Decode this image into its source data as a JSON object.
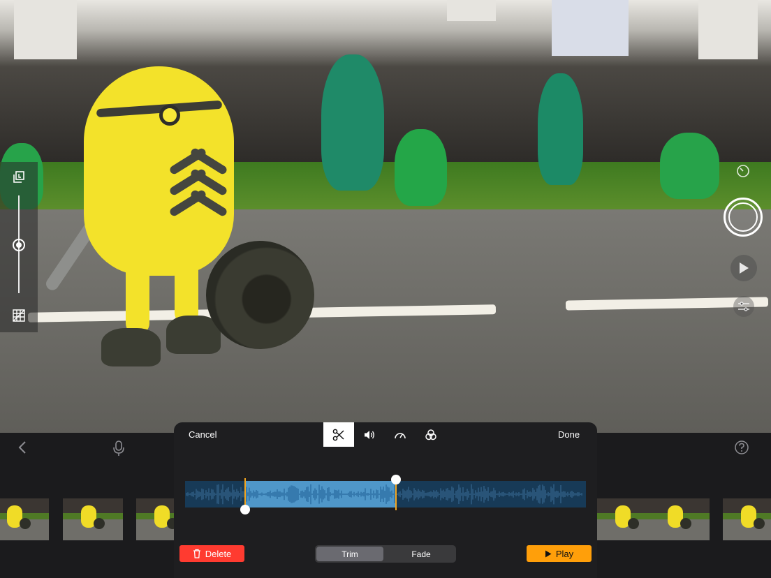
{
  "camera": {
    "shutter_icon": "record-circle-icon",
    "play_icon": "play-icon",
    "timer_icon": "timer-icon",
    "settings_icon": "sliders-icon"
  },
  "left_panel": {
    "top_icon": "layers-icon",
    "bottom_icon": "grid-icon",
    "zoom_level": 0.5
  },
  "toolbar": {
    "back_icon": "chevron-left-icon",
    "mic_icon": "microphone-icon",
    "help_icon": "help-icon"
  },
  "edit_panel": {
    "cancel_label": "Cancel",
    "done_label": "Done",
    "tabs": [
      {
        "name": "trim",
        "icon": "scissors-icon",
        "active": true
      },
      {
        "name": "volume",
        "icon": "speaker-icon",
        "active": false
      },
      {
        "name": "speed",
        "icon": "speedometer-icon",
        "active": false
      },
      {
        "name": "filters",
        "icon": "filters-icon",
        "active": false
      }
    ],
    "delete_label": "Delete",
    "segments": [
      "Trim",
      "Fade"
    ],
    "selected_segment": "Trim",
    "play_label": "Play",
    "trim": {
      "start": 0.15,
      "end": 0.526
    }
  },
  "colors": {
    "delete": "#ff3b30",
    "play": "#ff9f0a",
    "selection": "#4f97c9",
    "waveform_bg": "#173a57",
    "trim_handle": "#f2a51e"
  }
}
